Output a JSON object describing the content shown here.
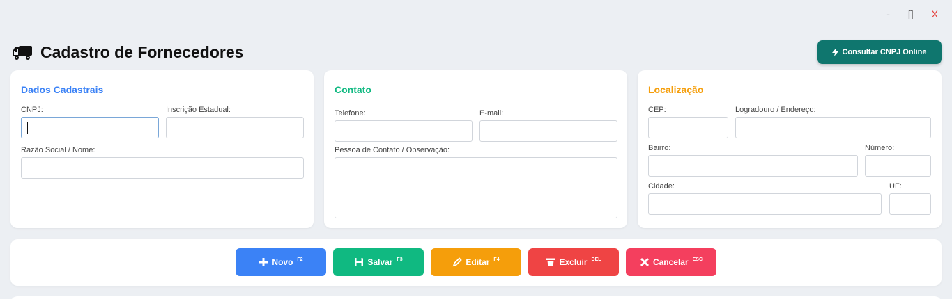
{
  "window": {
    "minimize": "-",
    "maximize": "[]",
    "close": "X"
  },
  "page": {
    "title": "Cadastro de Fornecedores",
    "title_icon": "truck-icon"
  },
  "header_button": {
    "label": "Consultar CNPJ Online",
    "icon": "bolt-icon"
  },
  "colors": {
    "blue": "#3b82f6",
    "green": "#10b981",
    "orange": "#f59e0b",
    "teal": "#0f766e",
    "red": "#ef4444",
    "pink": "#f43f5e"
  },
  "cards": {
    "dados": {
      "title": "Dados Cadastrais",
      "cnpj_label": "CNPJ:",
      "cnpj_value": "",
      "ie_label": "Inscrição Estadual:",
      "ie_value": "",
      "razao_label": "Razão Social / Nome:",
      "razao_value": ""
    },
    "contato": {
      "title": "Contato",
      "telefone_label": "Telefone:",
      "email_label": "E-mail:",
      "pessoa_label": "Pessoa de Contato / Observação:"
    },
    "localizacao": {
      "title": "Localização",
      "cep_label": "CEP:",
      "logradouro_label": "Logradouro / Endereço:",
      "bairro_label": "Bairro:",
      "numero_label": "Número:",
      "cidade_label": "Cidade:",
      "uf_label": "UF:"
    }
  },
  "actions": [
    {
      "label": "Novo",
      "shortcut": "F2",
      "icon": "plus-icon"
    },
    {
      "label": "Salvar",
      "shortcut": "F3",
      "icon": "save-icon"
    },
    {
      "label": "Editar",
      "shortcut": "F4",
      "icon": "pencil-icon"
    },
    {
      "label": "Excluir",
      "shortcut": "DEL",
      "icon": "trash-icon"
    },
    {
      "label": "Cancelar",
      "shortcut": "ESC",
      "icon": "x-icon"
    }
  ]
}
